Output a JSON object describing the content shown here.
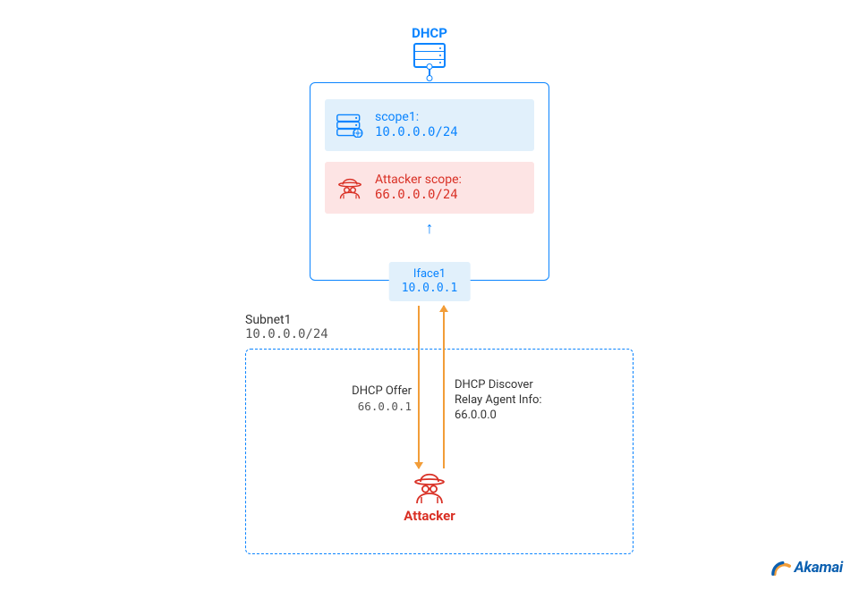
{
  "title": "DHCP",
  "scopes": {
    "scope1": {
      "label": "scope1:",
      "cidr": "10.0.0.0/24"
    },
    "attackerScope": {
      "label": "Attacker scope:",
      "cidr": "66.0.0.0/24"
    }
  },
  "iface": {
    "label": "Iface1",
    "ip": "10.0.0.1"
  },
  "subnet": {
    "label": "Subnet1",
    "cidr": "10.0.0.0/24"
  },
  "flowLeft": {
    "title": "DHCP Offer",
    "value": "66.0.0.1"
  },
  "flowRight": {
    "title": "DHCP Discover",
    "sub1": "Relay Agent Info:",
    "sub2": "66.0.0.0"
  },
  "attacker": "Attacker",
  "brand": "Akamai",
  "colors": {
    "primary": "#0a84ff",
    "danger": "#d93025",
    "accent": "#f29d38"
  }
}
